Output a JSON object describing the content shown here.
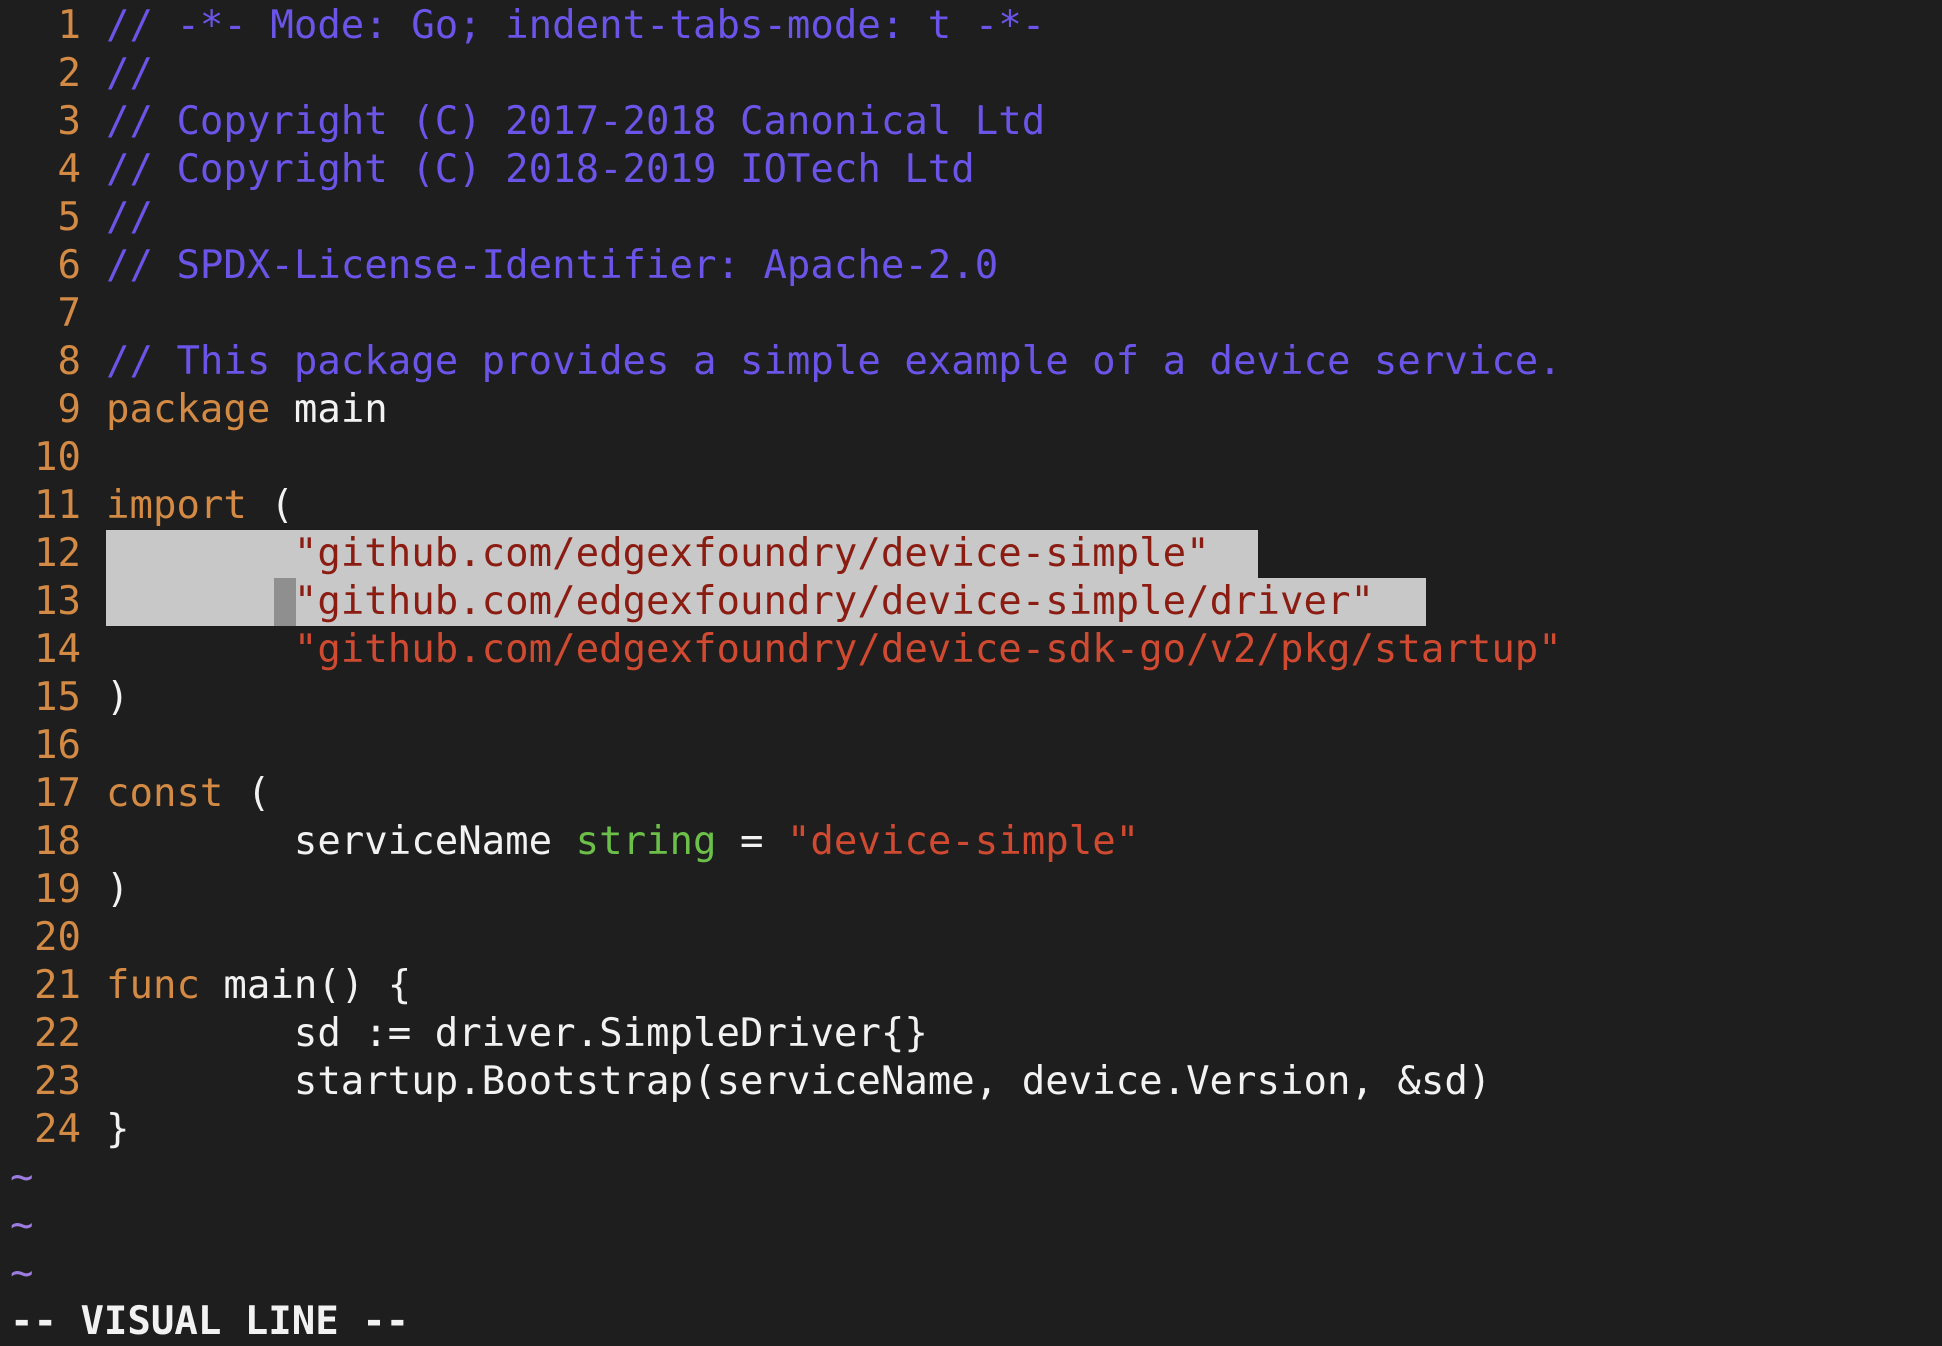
{
  "editor": {
    "lines": [
      {
        "n": "1",
        "segments": [
          {
            "t": "// -*- Mode: Go; indent-tabs-mode: t -*-",
            "c": "comment"
          }
        ]
      },
      {
        "n": "2",
        "segments": [
          {
            "t": "//",
            "c": "comment"
          }
        ]
      },
      {
        "n": "3",
        "segments": [
          {
            "t": "// Copyright (C) 2017-2018 Canonical Ltd",
            "c": "comment"
          }
        ]
      },
      {
        "n": "4",
        "segments": [
          {
            "t": "// Copyright (C) 2018-2019 IOTech Ltd",
            "c": "comment"
          }
        ]
      },
      {
        "n": "5",
        "segments": [
          {
            "t": "//",
            "c": "comment"
          }
        ]
      },
      {
        "n": "6",
        "segments": [
          {
            "t": "// SPDX-License-Identifier: Apache-2.0",
            "c": "comment"
          }
        ]
      },
      {
        "n": "7",
        "segments": []
      },
      {
        "n": "8",
        "segments": [
          {
            "t": "// This package provides a simple example of a device service.",
            "c": "comment"
          }
        ]
      },
      {
        "n": "9",
        "segments": [
          {
            "t": "package",
            "c": "kw"
          },
          {
            "t": " main",
            "c": "plain"
          }
        ]
      },
      {
        "n": "10",
        "segments": []
      },
      {
        "n": "11",
        "segments": [
          {
            "t": "import",
            "c": "kw"
          },
          {
            "t": " (",
            "c": "plain"
          }
        ]
      },
      {
        "n": "12",
        "segments": [
          {
            "t": "        ",
            "c": "plain"
          },
          {
            "t": "\"github.com/edgexfoundry/device-simple\"",
            "c": "sel-text-str"
          }
        ],
        "selected": true
      },
      {
        "n": "13",
        "segments": [
          {
            "t": "        ",
            "c": "plain"
          },
          {
            "t": "\"github.com/edgexfoundry/device-simple/driver\"",
            "c": "sel-text-str"
          }
        ],
        "selected": true
      },
      {
        "n": "14",
        "segments": [
          {
            "t": "        ",
            "c": "plain"
          },
          {
            "t": "\"github.com/edgexfoundry/device-sdk-go/v2/pkg/startup\"",
            "c": "str"
          }
        ]
      },
      {
        "n": "15",
        "segments": [
          {
            "t": ")",
            "c": "plain"
          }
        ]
      },
      {
        "n": "16",
        "segments": []
      },
      {
        "n": "17",
        "segments": [
          {
            "t": "const",
            "c": "kw"
          },
          {
            "t": " (",
            "c": "plain"
          }
        ]
      },
      {
        "n": "18",
        "segments": [
          {
            "t": "        serviceName ",
            "c": "plain"
          },
          {
            "t": "string",
            "c": "type"
          },
          {
            "t": " = ",
            "c": "plain"
          },
          {
            "t": "\"device-simple\"",
            "c": "str"
          }
        ]
      },
      {
        "n": "19",
        "segments": [
          {
            "t": ")",
            "c": "plain"
          }
        ]
      },
      {
        "n": "20",
        "segments": []
      },
      {
        "n": "21",
        "segments": [
          {
            "t": "func",
            "c": "kw"
          },
          {
            "t": " main() {",
            "c": "plain"
          }
        ]
      },
      {
        "n": "22",
        "segments": [
          {
            "t": "        sd := driver.SimpleDriver{}",
            "c": "plain"
          }
        ]
      },
      {
        "n": "23",
        "segments": [
          {
            "t": "        startup.Bootstrap(serviceName, device.Version, &sd)",
            "c": "plain"
          }
        ]
      },
      {
        "n": "24",
        "segments": [
          {
            "t": "}",
            "c": "plain"
          }
        ]
      }
    ],
    "tildes": [
      "~",
      "~",
      "~"
    ]
  },
  "status": {
    "mode": "-- VISUAL LINE --"
  },
  "colors": {
    "background": "#1e1e1e",
    "line_number": "#d38a44",
    "comment": "#6a55e8",
    "keyword": "#d38a44",
    "string": "#cf4a31",
    "type": "#6cc04a",
    "selection": "#c8c8c8",
    "tilde": "#9d7be0"
  }
}
